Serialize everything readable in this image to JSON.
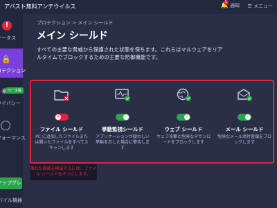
{
  "app": {
    "title": "アバスト無料アンチウイルス",
    "notifications_label": "通知",
    "notifications_count": "1",
    "menu_label": "メニュー"
  },
  "sidebar": {
    "status_label": "ステータス",
    "protection_label": "プロテクション",
    "privacy_label": "プライバシー",
    "privacy_tag": "ベータ版",
    "performance_label": "パフォーマンス",
    "upgrade_label": "アップグレード",
    "mobile_label": "モバイル機器"
  },
  "main": {
    "breadcrumb": "プロテクション > メイン シールド",
    "title": "メイン シールド",
    "description": "すべての主要な脅威から保護された状態を保ちます。これらはマルウェアをリアルタイムでブロックするための主要な防御機能です。"
  },
  "shields": [
    {
      "title": "ファイル シールド",
      "desc": "PC に追加したファイルまたは開いたファイルをすべてスキャンします",
      "enabled": false,
      "icon": "folder-icon"
    },
    {
      "title": "挙動監視シールド",
      "desc": "アプリケーションが疑わしい挙動を示した場合に警告します",
      "enabled": true,
      "icon": "behavior-monitor-icon"
    },
    {
      "title": "ウェブ シールド",
      "desc": "ウェブ攻撃と危険なダウンロードをブロックします",
      "enabled": true,
      "icon": "globe-icon"
    },
    {
      "title": "メール シールド",
      "desc": "危険なメール添付書類をブロックします",
      "enabled": true,
      "icon": "mail-icon"
    }
  ],
  "tooltip": {
    "text": "隠れた脅威を検出するには、ファイル シールドをオンにします。"
  },
  "colors": {
    "accent_purple": "#7a3fd8",
    "danger_red": "#e0263b",
    "ok_green": "#2aa54b",
    "background": "#2a2e47"
  }
}
